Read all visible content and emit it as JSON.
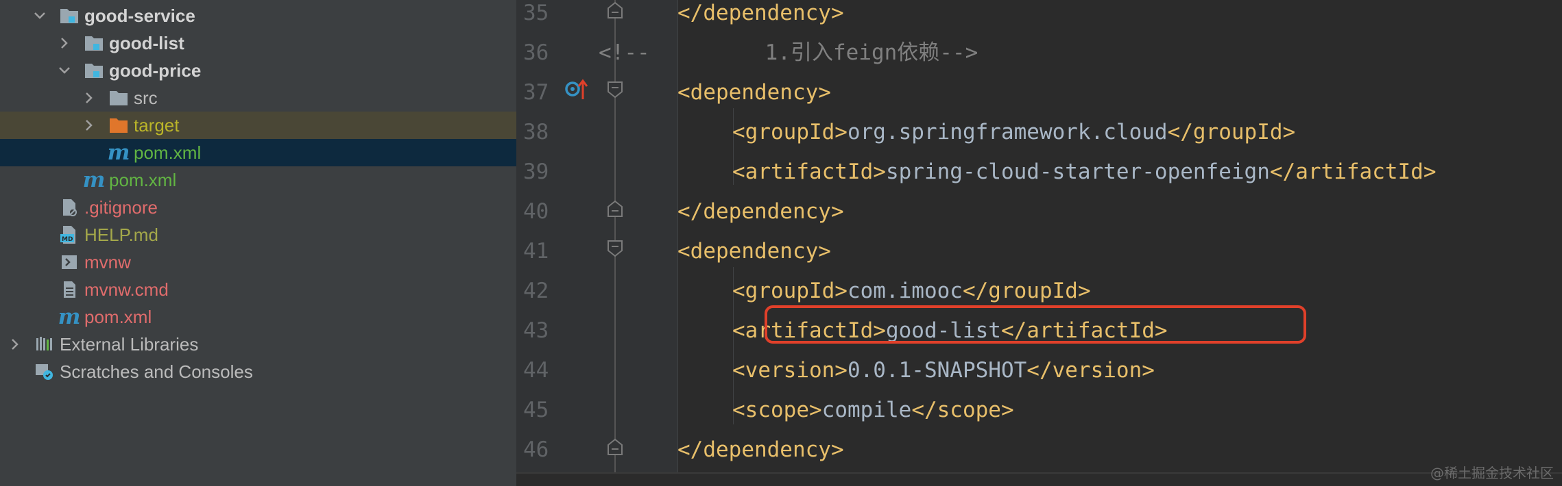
{
  "project_tree": {
    "items": [
      {
        "label": "good-service",
        "icon": "module-folder-icon"
      },
      {
        "label": "good-list",
        "icon": "module-folder-icon"
      },
      {
        "label": "good-price",
        "icon": "module-folder-icon"
      },
      {
        "label": "src",
        "icon": "folder-icon"
      },
      {
        "label": "target",
        "icon": "excluded-folder-icon"
      },
      {
        "label": "pom.xml",
        "icon": "maven-icon"
      },
      {
        "label": "pom.xml",
        "icon": "maven-icon"
      },
      {
        "label": ".gitignore",
        "icon": "gitignore-icon"
      },
      {
        "label": "HELP.md",
        "icon": "markdown-icon"
      },
      {
        "label": "mvnw",
        "icon": "shell-script-icon"
      },
      {
        "label": "mvnw.cmd",
        "icon": "text-file-icon"
      },
      {
        "label": "pom.xml",
        "icon": "maven-icon"
      },
      {
        "label": "External Libraries",
        "icon": "libraries-icon"
      },
      {
        "label": "Scratches and Consoles",
        "icon": "scratches-icon"
      }
    ],
    "colors": {
      "background": "#3c3f41",
      "selected": "#0d293e",
      "excluded": "#4a4736"
    }
  },
  "editor": {
    "lines": [
      {
        "num": "35",
        "tokens": [
          {
            "t": "</dependency>",
            "c": "tag"
          }
        ]
      },
      {
        "num": "36",
        "tokens": [
          {
            "t": "<!--         1.引入feign依赖-->",
            "c": "cmt"
          }
        ]
      },
      {
        "num": "37",
        "tokens": [
          {
            "t": "<dependency>",
            "c": "tag"
          }
        ]
      },
      {
        "num": "38",
        "tokens": [
          {
            "t": "<groupId>",
            "c": "tag"
          },
          {
            "t": "org.springframework.cloud",
            "c": "txt"
          },
          {
            "t": "</groupId>",
            "c": "tag"
          }
        ]
      },
      {
        "num": "39",
        "tokens": [
          {
            "t": "<artifactId>",
            "c": "tag"
          },
          {
            "t": "spring-cloud-starter-openfeign",
            "c": "txt"
          },
          {
            "t": "</artifactId>",
            "c": "tag"
          }
        ]
      },
      {
        "num": "40",
        "tokens": [
          {
            "t": "</dependency>",
            "c": "tag"
          }
        ]
      },
      {
        "num": "41",
        "tokens": [
          {
            "t": "<dependency>",
            "c": "tag"
          }
        ]
      },
      {
        "num": "42",
        "tokens": [
          {
            "t": "<groupId>",
            "c": "tag"
          },
          {
            "t": "com.imooc",
            "c": "txt"
          },
          {
            "t": "</groupId>",
            "c": "tag"
          }
        ]
      },
      {
        "num": "43",
        "tokens": [
          {
            "t": "<artifactId>",
            "c": "tag"
          },
          {
            "t": "good-list",
            "c": "txt"
          },
          {
            "t": "</artifactId>",
            "c": "tag"
          }
        ]
      },
      {
        "num": "44",
        "tokens": [
          {
            "t": "<version>",
            "c": "tag"
          },
          {
            "t": "0.0.1-SNAPSHOT",
            "c": "txt"
          },
          {
            "t": "</version>",
            "c": "tag"
          }
        ]
      },
      {
        "num": "45",
        "tokens": [
          {
            "t": "<scope>",
            "c": "tag"
          },
          {
            "t": "compile",
            "c": "txt"
          },
          {
            "t": "</scope>",
            "c": "tag"
          }
        ]
      },
      {
        "num": "46",
        "tokens": [
          {
            "t": "</dependency>",
            "c": "tag"
          }
        ]
      }
    ],
    "gutter_marker": "maven-dependency-icon",
    "colors": {
      "tag": "#e8bf6a",
      "text": "#a9b7c6",
      "comment": "#808080",
      "highlight_box": "#e0402a"
    }
  },
  "watermark": "@稀土掘金技术社区"
}
